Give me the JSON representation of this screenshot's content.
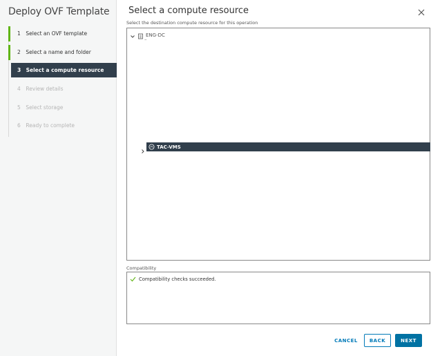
{
  "wizard": {
    "title": "Deploy OVF Template",
    "steps": [
      {
        "num": "1",
        "label": "Select an OVF template",
        "state": "done"
      },
      {
        "num": "2",
        "label": "Select a name and folder",
        "state": "done"
      },
      {
        "num": "3",
        "label": "Select a compute resource",
        "state": "active"
      },
      {
        "num": "4",
        "label": "Review details",
        "state": "disabled"
      },
      {
        "num": "5",
        "label": "Select storage",
        "state": "disabled"
      },
      {
        "num": "6",
        "label": "Ready to complete",
        "state": "disabled"
      }
    ]
  },
  "main": {
    "title": "Select a compute resource",
    "close_icon": "close-icon",
    "instruction": "Select the destination compute resource for this operation",
    "tree": {
      "root_label": "ENG-DC",
      "root_icon": "datacenter-icon",
      "placeholder": "–",
      "selected_label": "TAC-VMS",
      "selected_icon": "resource-pool-icon"
    },
    "compatibility": {
      "label": "Compatibility",
      "message": "Compatibility checks succeeded.",
      "icon": "check-icon"
    }
  },
  "footer": {
    "cancel": "CANCEL",
    "back": "BACK",
    "next": "NEXT"
  },
  "colors": {
    "active_step_bg": "#313f4c",
    "done_marker": "#60b515",
    "primary": "#0072a3",
    "link": "#0079b8",
    "check": "#60b515"
  }
}
